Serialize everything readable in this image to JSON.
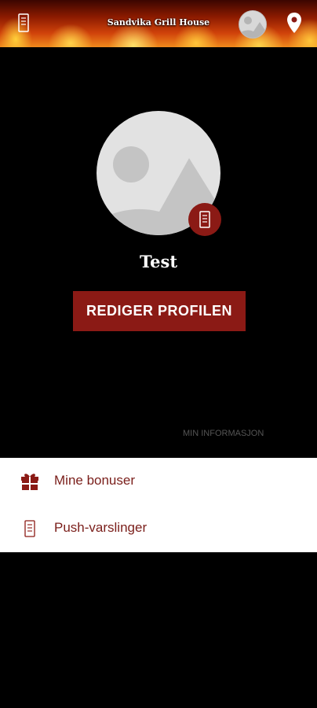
{
  "header": {
    "title": "Sandvika Grill House",
    "left_icon": "menu-card-icon",
    "avatar_icon": "profile-avatar-icon",
    "right_icon": "location-pin-icon"
  },
  "profile": {
    "avatar_icon": "image-placeholder-icon",
    "badge_icon": "menu-card-icon",
    "name": "Test",
    "edit_button": "REDIGER PROFILEN"
  },
  "section": {
    "label": "MIN INFORMASJON"
  },
  "menu": {
    "items": [
      {
        "label": "Mine bonuser",
        "icon": "gift-icon"
      },
      {
        "label": "Push-varslinger",
        "icon": "menu-card-icon"
      }
    ]
  },
  "colors": {
    "accent": "#8b1a15",
    "menu_text": "#7a1e1a",
    "background": "#000000"
  }
}
